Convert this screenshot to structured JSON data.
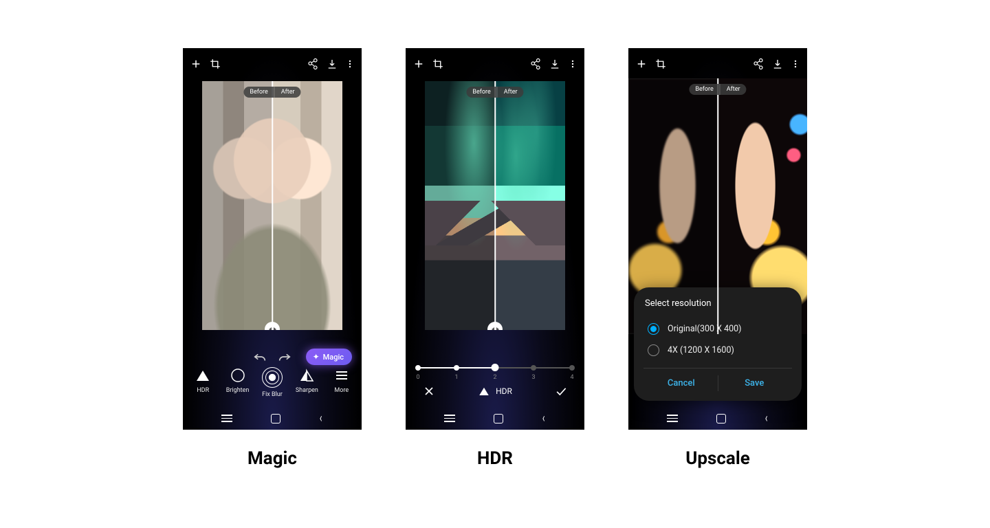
{
  "captions": {
    "magic": "Magic",
    "hdr": "HDR",
    "upscale": "Upscale"
  },
  "compare": {
    "before": "Before",
    "after": "After"
  },
  "magic_screen": {
    "button_label": "Magic",
    "tools": {
      "hdr": "HDR",
      "brighten": "Brighten",
      "fixblur": "Fix Blur",
      "sharpen": "Sharpen",
      "more": "More"
    }
  },
  "hdr_screen": {
    "label": "HDR",
    "ticks": {
      "t0": "0",
      "t1": "1",
      "t2": "2",
      "t3": "3",
      "t4": "4"
    },
    "value": 2
  },
  "upscale_screen": {
    "dialog_title": "Select resolution",
    "option_original": "Original(300 X 400)",
    "option_4x": "4X (1200 X 1600)",
    "cancel": "Cancel",
    "save": "Save"
  }
}
